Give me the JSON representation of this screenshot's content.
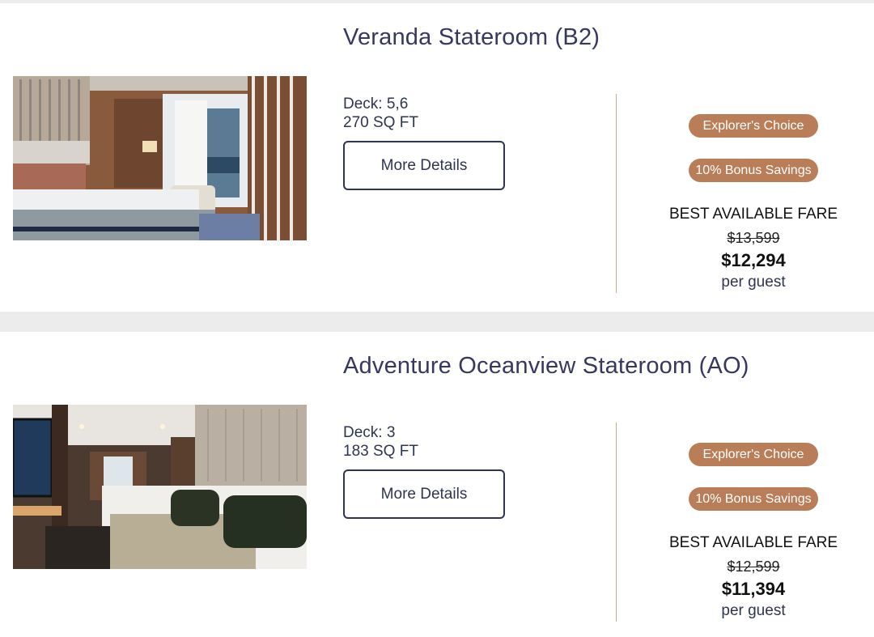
{
  "cabins": [
    {
      "title": "Veranda Stateroom (B2)",
      "deck": "Deck: 5,6",
      "size": "270 SQ FT",
      "details_label": "More Details",
      "badges": [
        "Explorer's Choice",
        "10% Bonus Savings"
      ],
      "fare_label": "BEST AVAILABLE FARE",
      "original_price": "$13,599",
      "price": "$12,294",
      "price_unit": "per guest"
    },
    {
      "title": "Adventure Oceanview Stateroom (AO)",
      "deck": "Deck: 3",
      "size": "183 SQ FT",
      "details_label": "More Details",
      "badges": [
        "Explorer's Choice",
        "10% Bonus Savings"
      ],
      "fare_label": "BEST AVAILABLE FARE",
      "original_price": "$12,599",
      "price": "$11,394",
      "price_unit": "per guest"
    }
  ],
  "colors": {
    "title": "#36385e",
    "badge": "#b97e58",
    "divider": "#c9a98a",
    "button_border": "#2d3550"
  }
}
